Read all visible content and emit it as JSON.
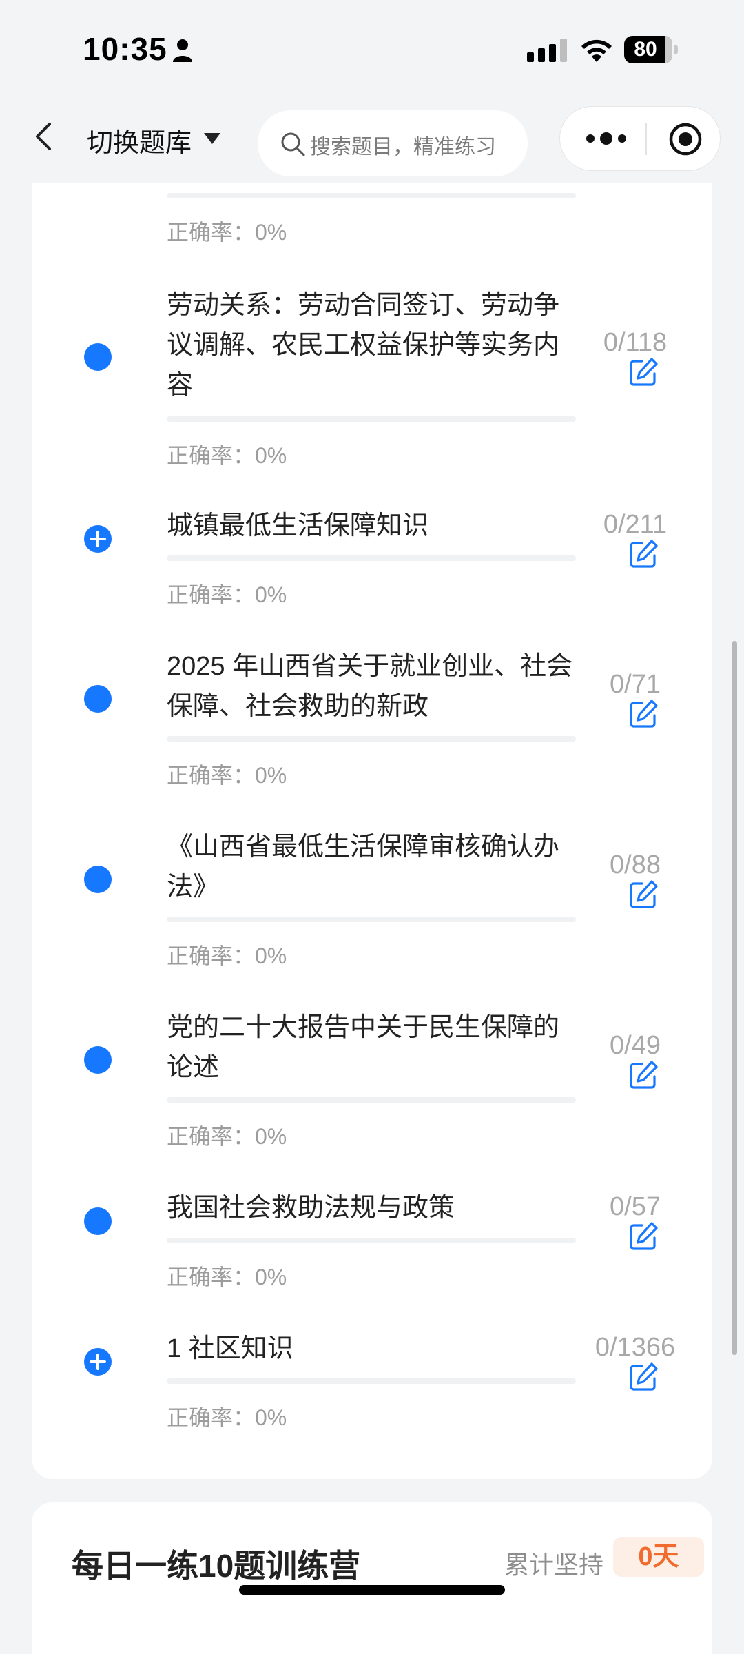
{
  "status_bar": {
    "time": "10:35",
    "battery": "80"
  },
  "nav": {
    "title": "切换题库",
    "search_placeholder": "搜索题目，精准练习"
  },
  "colors": {
    "accent": "#1677ff",
    "muted_text": "#9c9c9c",
    "streak": "#f26b2e"
  },
  "top_partial_item": {
    "accuracy": "正确率：0%"
  },
  "items": [
    {
      "title": "劳动关系：劳动合同签订、劳动争议调解、农民工权益保护等实务内容",
      "count": "0/118",
      "accuracy": "正确率：0%",
      "icon": "dot-icon"
    },
    {
      "title": "城镇最低生活保障知识",
      "count": "0/211",
      "accuracy": "正确率：0%",
      "icon": "expand-plus-icon"
    },
    {
      "title": "2025 年山西省关于就业创业、社会保障、社会救助的新政",
      "count": "0/71",
      "accuracy": "正确率：0%",
      "icon": "dot-icon"
    },
    {
      "title": "《山西省最低生活保障审核确认办法》",
      "count": "0/88",
      "accuracy": "正确率：0%",
      "icon": "dot-icon"
    },
    {
      "title": "党的二十大报告中关于民生保障的论述",
      "count": "0/49",
      "accuracy": "正确率：0%",
      "icon": "dot-icon"
    },
    {
      "title": "我国社会救助法规与政策",
      "count": "0/57",
      "accuracy": "正确率：0%",
      "icon": "dot-icon"
    },
    {
      "title": "1 社区知识",
      "count": "0/1366",
      "accuracy": "正确率：0%",
      "icon": "expand-plus-icon"
    }
  ],
  "training_camp": {
    "title": "每日一练10题训练营",
    "streak_label": "累计坚持",
    "streak_value": "0天"
  }
}
